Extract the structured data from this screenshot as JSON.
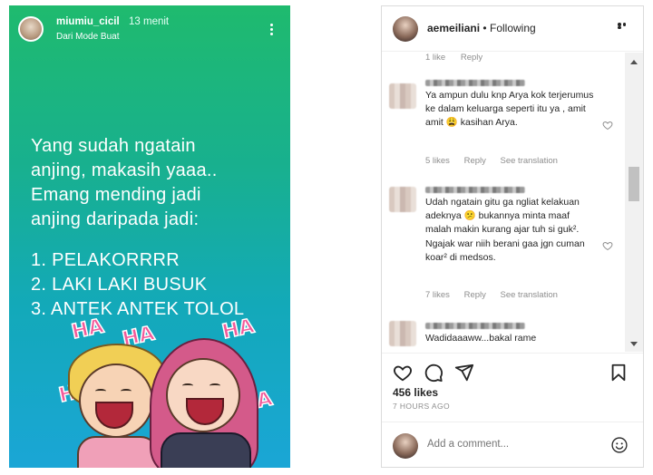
{
  "story": {
    "username": "miumiu_cicil",
    "time": "13 menit",
    "subtitle": "Dari Mode Buat",
    "text_lines": [
      "Yang sudah ngatain",
      "anjing, makasih yaaa..",
      "Emang mending jadi",
      "anjing daripada jadi:"
    ],
    "list_lines": [
      "1. PELAKORRRR",
      "2. LAKI LAKI BUSUK",
      "3. ANTEK ANTEK TOLOL"
    ],
    "sticker_text": "HA",
    "menu_icon": "vertical-dots-icon"
  },
  "post": {
    "header": {
      "username": "aemeiliani",
      "separator": "•",
      "follow_label": "Following",
      "more_icon": "horizontal-dots-icon"
    },
    "top_meta": {
      "likes": "1 like",
      "reply": "Reply"
    },
    "comments": [
      {
        "text": "Ya ampun dulu knp Arya kok terjerumus ke dalam keluarga seperti itu ya , amit amit 😩 kasihan Arya.",
        "likes": "5 likes",
        "reply": "Reply",
        "translate": "See translation"
      },
      {
        "text": "Udah ngatain gitu ga ngliat kelakuan adeknya 😕 bukannya minta maaf malah makin kurang ajar tuh si guk². Ngajak war niih berani gaa jgn cuman koar² di medsos.",
        "likes": "7 likes",
        "reply": "Reply",
        "translate": "See translation"
      },
      {
        "text": "Wadidaaaww...bakal rame",
        "likes": "",
        "reply": "",
        "translate": ""
      }
    ],
    "like_count": "456 likes",
    "timestamp": "7 HOURS AGO",
    "add_comment_placeholder": "Add a comment...",
    "icons": {
      "like": "heart-icon",
      "comment": "comment-icon",
      "share": "send-icon",
      "save": "bookmark-icon",
      "emoji": "smiley-icon"
    }
  },
  "colors": {
    "story_gradient_top": "#1fba6e",
    "story_gradient_bottom": "#1aa6d6",
    "ig_text": "#262626",
    "ig_meta": "#8e8e8e",
    "sticker_pink": "#f25a9a"
  }
}
